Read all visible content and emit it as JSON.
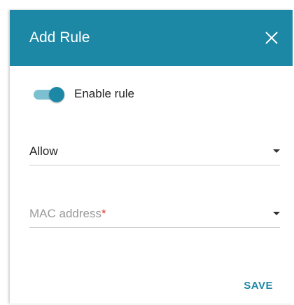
{
  "dialog": {
    "title": "Add Rule",
    "close_icon": "close-icon"
  },
  "toggle": {
    "label": "Enable rule",
    "checked": true
  },
  "action_select": {
    "value": "Allow"
  },
  "mac_select": {
    "placeholder": "MAC address",
    "required_mark": "*"
  },
  "footer": {
    "save_label": "SAVE"
  },
  "colors": {
    "accent": "#1c88a5",
    "toggle_track": "#7cc0d2",
    "required": "#e53935"
  }
}
